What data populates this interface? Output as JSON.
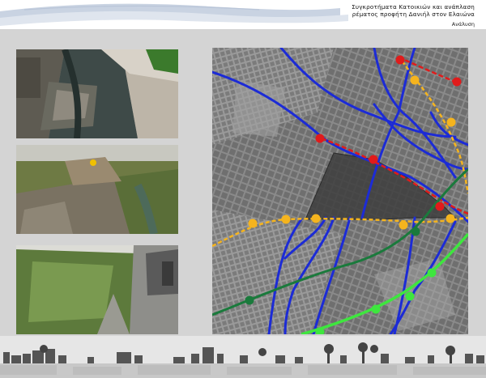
{
  "header": {
    "title_line1": "Συγκροτήματα Κατοικιών και ανάπλαση",
    "title_line2": "ρέματος προφήτη Δανιήλ στον Ελαιώνα",
    "subtitle": "Ανάλυση"
  },
  "photos": [
    {
      "name": "stream-photo-concrete-channel"
    },
    {
      "name": "stream-photo-overgrown-bank"
    },
    {
      "name": "stream-photo-reeds-walls"
    }
  ],
  "map": {
    "colors": {
      "background": "#7d7d7d",
      "roads_primary": "#1c2bd6",
      "line_red": "#e01b1b",
      "line_orange": "#f5b41e",
      "line_dark_green": "#1a7a3c",
      "line_light_green": "#3ee63e",
      "study_area": "#3e3e3e"
    }
  }
}
